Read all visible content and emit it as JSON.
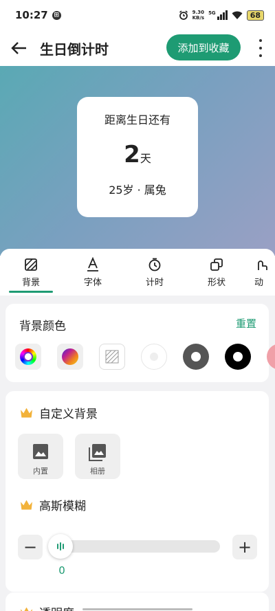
{
  "status": {
    "time": "10:27",
    "net_speed": "9.30",
    "net_unit": "KB/s",
    "signal": "5G",
    "battery": "68"
  },
  "appbar": {
    "title": "生日倒计时",
    "favorite_label": "添加到收藏"
  },
  "countdown": {
    "label": "距离生日还有",
    "days": "2",
    "days_unit": "天",
    "age": "25岁 · 属兔"
  },
  "tabs": [
    {
      "label": "背景",
      "icon": "background-icon"
    },
    {
      "label": "字体",
      "icon": "font-icon"
    },
    {
      "label": "计时",
      "icon": "timer-icon"
    },
    {
      "label": "形状",
      "icon": "shape-icon"
    },
    {
      "label": "动",
      "icon": "animation-icon"
    }
  ],
  "bg_color": {
    "title": "背景颜色",
    "reset_label": "重置"
  },
  "custom_bg": {
    "title": "自定义背景",
    "builtin_label": "内置",
    "album_label": "相册"
  },
  "blur": {
    "title": "高斯模糊",
    "value": "0",
    "fraction": 0.0
  },
  "opacity": {
    "title": "透明度"
  },
  "colors": {
    "accent": "#1e9b73",
    "crown": "#f2b23a",
    "gradient_start": "#5aa9b4",
    "gradient_end": "#9aa0c4"
  }
}
